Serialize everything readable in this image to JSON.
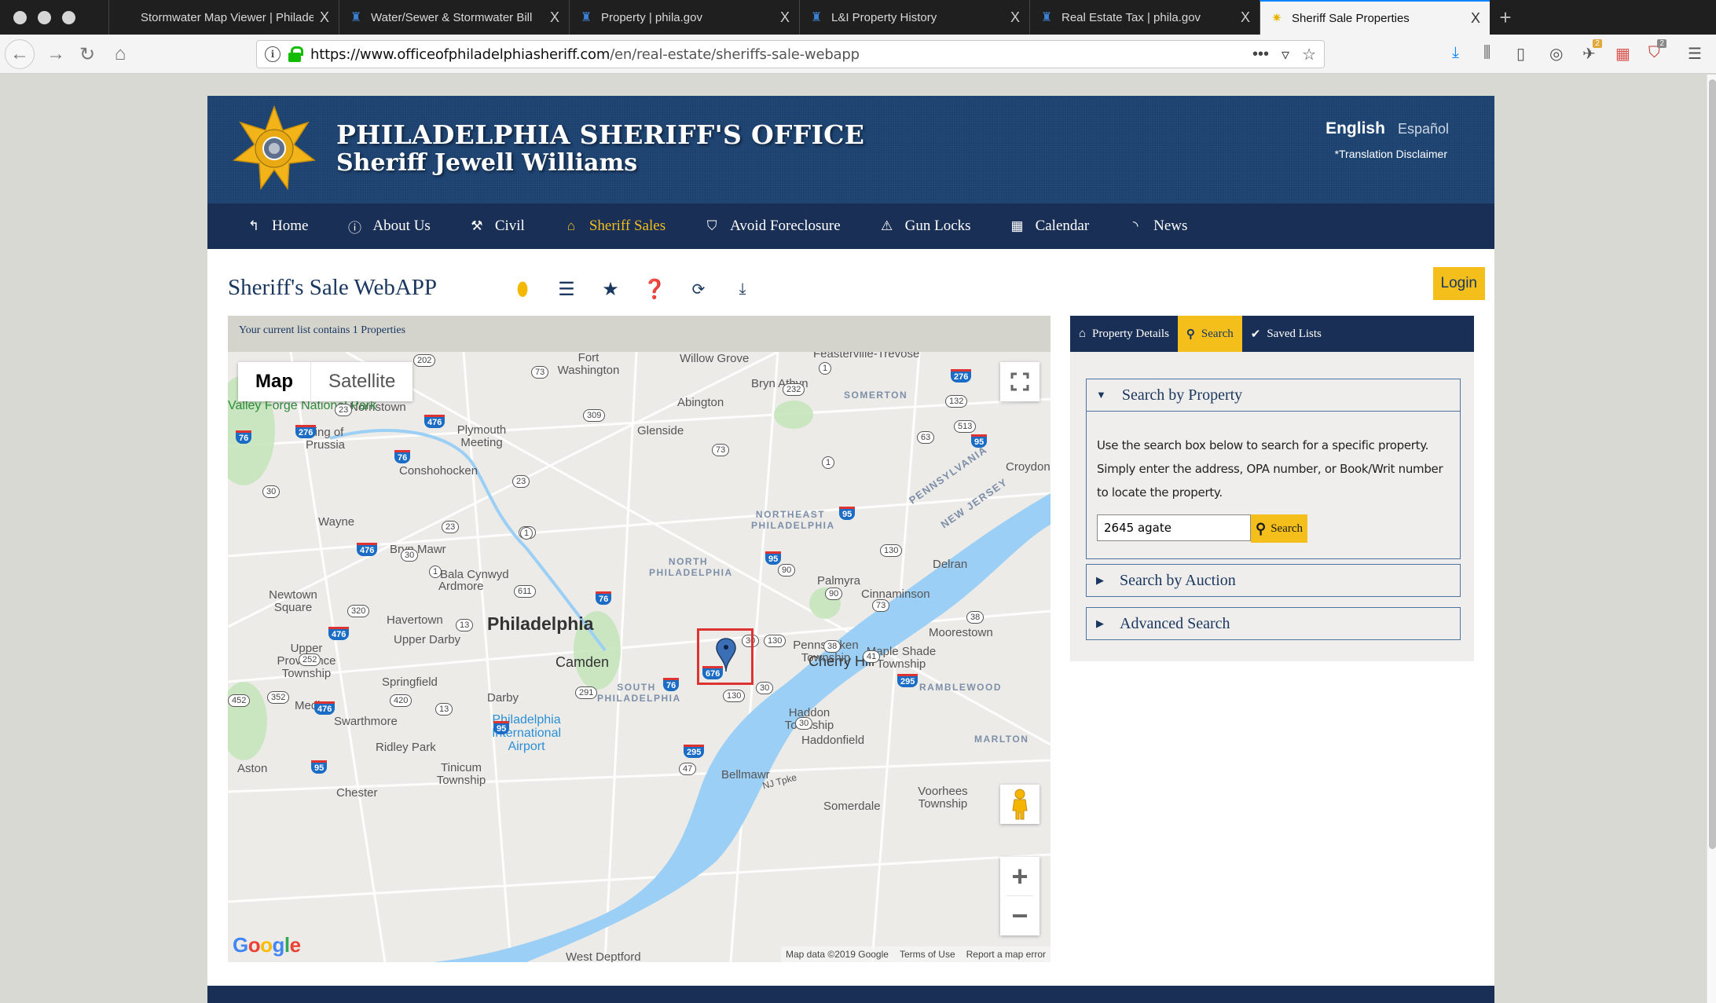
{
  "browser": {
    "tabs": [
      {
        "label": "Stormwater Map Viewer | Philadelphi",
        "icon": "globe-icon",
        "active": false
      },
      {
        "label": "Water/Sewer & Stormwater Bill",
        "icon": "phila-bell-icon",
        "active": false
      },
      {
        "label": "Property | phila.gov",
        "icon": "phila-bell-icon",
        "active": false
      },
      {
        "label": "L&I Property History",
        "icon": "phila-bell-icon",
        "active": false
      },
      {
        "label": "Real Estate Tax | phila.gov",
        "icon": "phila-bell-icon",
        "active": false
      },
      {
        "label": "Sheriff Sale Properties",
        "icon": "sheriff-star-icon",
        "active": true
      }
    ],
    "close_glyph": "X",
    "new_tab_glyph": "+",
    "url_host": "https://www.officeofphiladelphiasheriff.com",
    "url_path": "/en/real-estate/sheriffs-sale-webapp",
    "url_more": "•••",
    "toolbar_badges": {
      "extension_one": "2",
      "extension_two": "2"
    }
  },
  "site": {
    "title": "PHILADELPHIA SHERIFF'S OFFICE",
    "subtitle": "Sheriff Jewell Williams",
    "lang_english": "English",
    "lang_spanish": "Español",
    "translation_disclaimer": "*Translation Disclaimer",
    "nav": [
      {
        "label": "Home",
        "icon": "reply-icon",
        "active": false
      },
      {
        "label": "About Us",
        "icon": "info-icon",
        "active": false
      },
      {
        "label": "Civil",
        "icon": "gavel-icon",
        "active": false
      },
      {
        "label": "Sheriff Sales",
        "icon": "home-icon",
        "active": true
      },
      {
        "label": "Avoid Foreclosure",
        "icon": "shield-icon",
        "active": false
      },
      {
        "label": "Gun Locks",
        "icon": "warning-icon",
        "active": false
      },
      {
        "label": "Calendar",
        "icon": "calendar-icon",
        "active": false
      },
      {
        "label": "News",
        "icon": "rss-icon",
        "active": false
      }
    ],
    "accent_color": "#f5bf1b",
    "brand_color": "#1a2f55"
  },
  "app": {
    "title": "Sheriff's Sale WebAPP",
    "login_label": "Login",
    "list_note": "Your current list contains 1 Properties",
    "tools": [
      "map-marker-icon",
      "list-icon",
      "star-icon",
      "help-icon",
      "refresh-icon",
      "download-icon"
    ]
  },
  "map": {
    "type_map": "Map",
    "type_satellite": "Satellite",
    "selected_type": "Map",
    "google": "Google",
    "attribution": "Map data ©2019 Google",
    "terms": "Terms of Use",
    "report": "Report a map error",
    "labels": {
      "philadelphia": "Philadelphia",
      "camden": "Camden",
      "cherry_hill": "Cherry Hill",
      "norristown": "Norristown",
      "king_of_prussia": "King of Prussia",
      "plymouth_meeting": "Plymouth Meeting",
      "conshohocken": "Conshohocken",
      "wayne": "Wayne",
      "bryn_mawr": "Bryn Mawr",
      "ardmore": "Ardmore",
      "bala_cynwyd": "Bala Cynwyd",
      "havertown": "Havertown",
      "upper_darby": "Upper Darby",
      "newtown_square": "Newtown Square",
      "upper_providence": "Upper Providence Township",
      "springfield": "Springfield",
      "media": "Media",
      "swarthmore": "Swarthmore",
      "darby": "Darby",
      "ridley_park": "Ridley Park",
      "aston": "Aston",
      "chester": "Chester",
      "tinicum": "Tinicum Township",
      "airport": "Philadelphia International Airport",
      "fort_washington": "Fort Washington",
      "willow_grove": "Willow Grove",
      "feasterville": "Feasterville-Trevose",
      "bryn_athyn": "Bryn Athyn",
      "abington": "Abington",
      "glenside": "Glenside",
      "somerton": "SOMERTON",
      "northeast_phila": "NORTHEAST PHILADELPHIA",
      "north_phila": "NORTH PHILADELPHIA",
      "south_phila": "SOUTH PHILADELPHIA",
      "palmyra": "Palmyra",
      "cinnaminson": "Cinnaminson",
      "delran": "Delran",
      "moorestown": "Moorestown",
      "pennsauken": "Pennsauken Township",
      "maple_shade": "Maple Shade Township",
      "haddon": "Haddon Township",
      "haddonfield": "Haddonfield",
      "bellmawr": "Bellmawr",
      "somerdale": "Somerdale",
      "voorhees": "Voorhees Township",
      "ramblewood": "RAMBLEWOOD",
      "marlton": "MARLTON",
      "croydon": "Croydon",
      "pennsylvania": "PENNSYLVANIA",
      "new_jersey": "NEW JERSEY",
      "valley_forge": "Valley Forge National Park",
      "nj_tpke": "NJ Tpke",
      "west_deptford": "West Deptford"
    }
  },
  "panel": {
    "tabs": [
      {
        "label": "Property Details",
        "icon": "home-icon",
        "active": false
      },
      {
        "label": "Search",
        "icon": "search-icon",
        "active": true
      },
      {
        "label": "Saved Lists",
        "icon": "check-icon",
        "active": false
      }
    ],
    "search_by_property": {
      "title": "Search by Property",
      "expanded": true,
      "description": "Use the search box below to search for a specific property. Simply enter the address, OPA number, or Book/Writ number to locate the property.",
      "input_value": "2645 agate",
      "button_label": "Search"
    },
    "search_by_auction": {
      "title": "Search by Auction",
      "expanded": false
    },
    "advanced_search": {
      "title": "Advanced Search",
      "expanded": false
    }
  }
}
